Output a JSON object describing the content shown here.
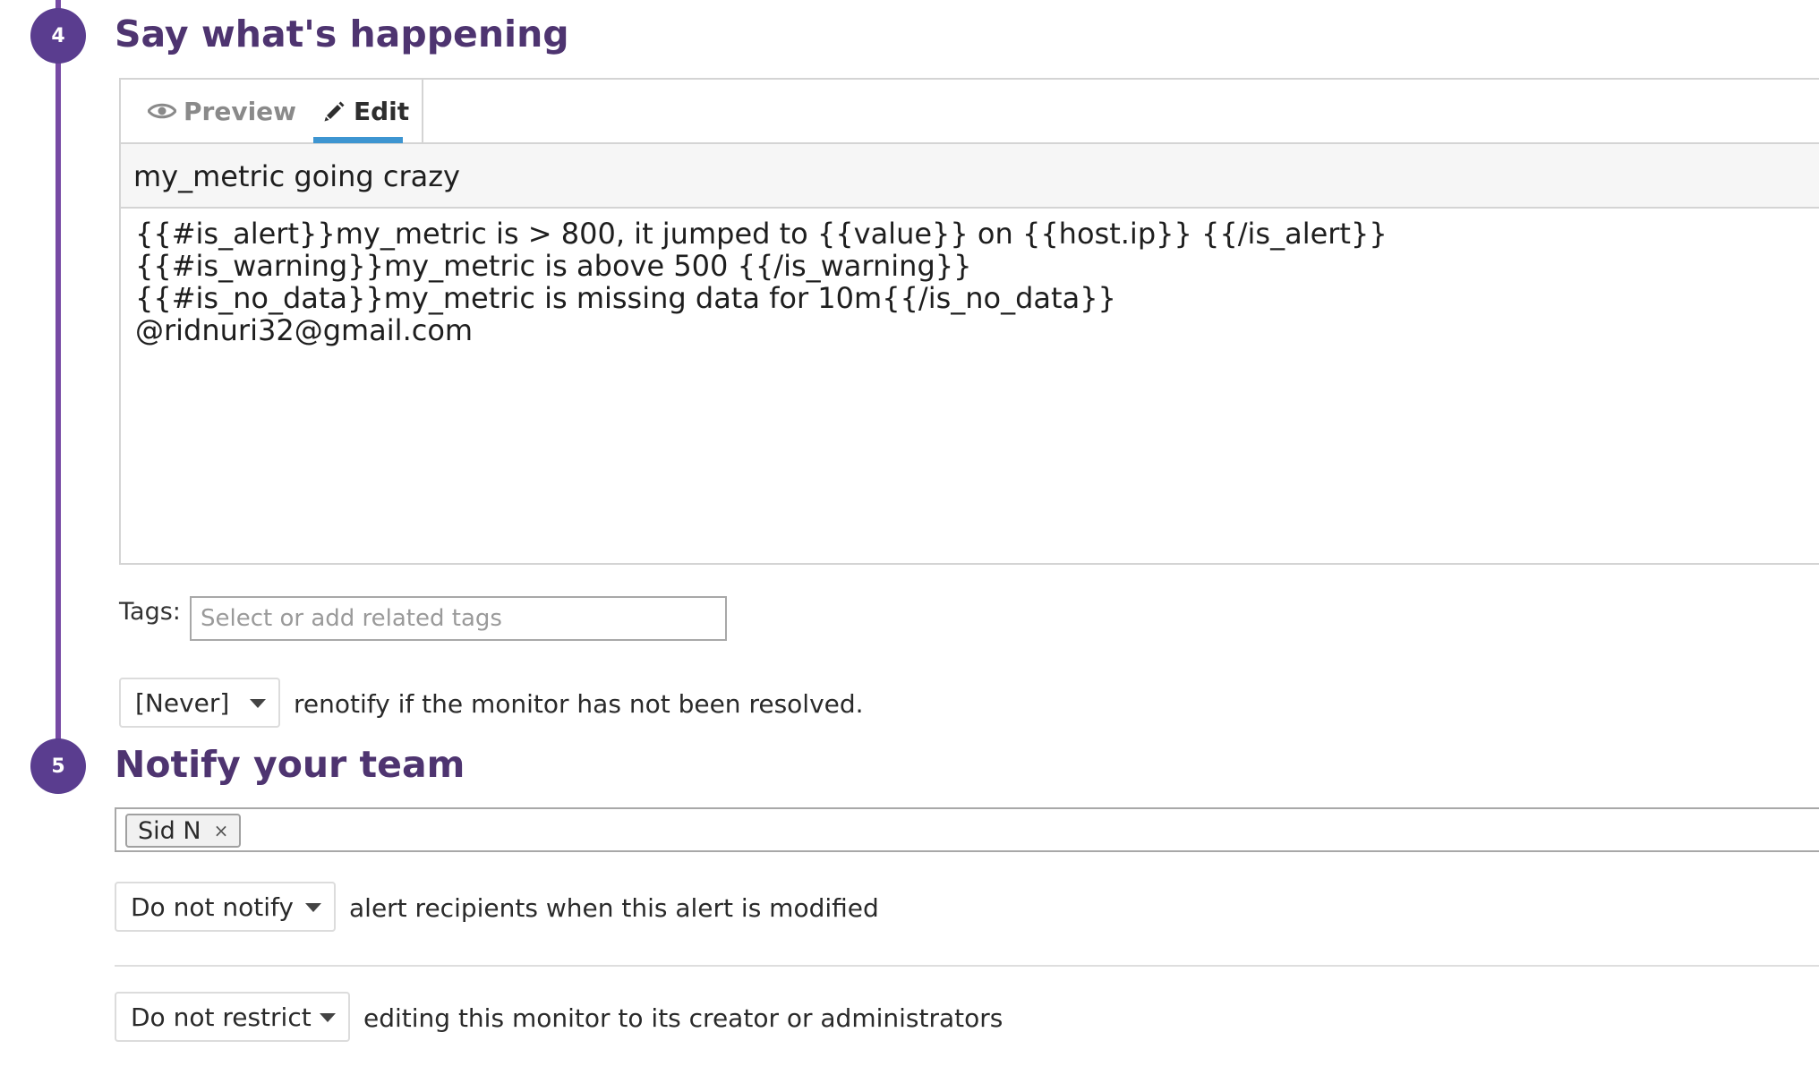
{
  "steps": [
    {
      "number": "4",
      "title": "Say what's happening"
    },
    {
      "number": "5",
      "title": "Notify your team"
    }
  ],
  "editor": {
    "tabs": {
      "preview": "Preview",
      "edit": "Edit"
    },
    "active_tab": "edit",
    "title_value": "my_metric going crazy",
    "body_lines": [
      "{{#is_alert}}my_metric is > 800, it jumped to {{value}} on {{host.ip}} {{/is_alert}}",
      "{{#is_warning}}my_metric is above 500 {{/is_warning}}",
      "{{#is_no_data}}my_metric is missing data for 10m{{/is_no_data}}",
      "@ridnuri32@gmail.com"
    ]
  },
  "tags": {
    "label": "Tags:",
    "placeholder": "Select or add related tags"
  },
  "renotify": {
    "selected": "[Never]",
    "text": "renotify if the monitor has not been resolved."
  },
  "notify_team": {
    "recipients": [
      {
        "name": "Sid N",
        "remove_icon": "×"
      }
    ],
    "modify_notify": {
      "selected": "Do not notify",
      "text": "alert recipients when this alert is modified"
    },
    "restrict": {
      "selected": "Do not restrict",
      "text": "editing this monitor to its creator or administrators"
    }
  },
  "colors": {
    "accent_purple": "#5a3d8f",
    "timeline": "#774aa4",
    "title_purple": "#4e3470",
    "tab_underline": "#3d95d1"
  },
  "icons": {
    "preview": "eye-icon",
    "edit": "pencil-icon",
    "dropdown": "caret-down-icon",
    "chip_remove": "close-icon"
  }
}
